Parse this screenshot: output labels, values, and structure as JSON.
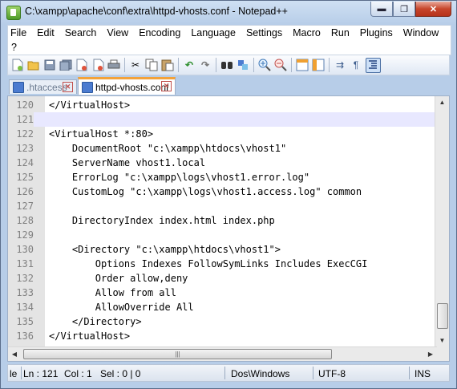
{
  "window": {
    "title": "C:\\xampp\\apache\\conf\\extra\\httpd-vhosts.conf - Notepad++",
    "controls": {
      "minimize": "▬",
      "maximize": "❐",
      "close": "✕"
    }
  },
  "menu": {
    "row1": [
      "File",
      "Edit",
      "Search",
      "View",
      "Encoding",
      "Language",
      "Settings",
      "Macro",
      "Run",
      "Plugins",
      "Window"
    ],
    "row2": [
      "?"
    ]
  },
  "toolbar": {
    "icons": [
      "new-file-icon",
      "open-file-icon",
      "save-icon",
      "save-all-icon",
      "close-icon",
      "close-all-icon",
      "print-icon",
      "cut-icon",
      "copy-icon",
      "paste-icon",
      "undo-icon",
      "redo-icon",
      "find-icon",
      "replace-icon",
      "zoom-in-icon",
      "zoom-out-icon",
      "sync-vertical-icon",
      "sync-horizontal-icon",
      "word-wrap-icon",
      "show-all-chars-icon",
      "indent-guide-icon"
    ]
  },
  "tabs": [
    {
      "label": ".htaccess",
      "active": false
    },
    {
      "label": "httpd-vhosts.conf",
      "active": true
    }
  ],
  "editor": {
    "current_line": "121",
    "lines": [
      {
        "num": "120",
        "text": "</VirtualHost>"
      },
      {
        "num": "121",
        "text": ""
      },
      {
        "num": "122",
        "text": "<VirtualHost *:80>"
      },
      {
        "num": "123",
        "text": "    DocumentRoot \"c:\\xampp\\htdocs\\vhost1\""
      },
      {
        "num": "124",
        "text": "    ServerName vhost1.local"
      },
      {
        "num": "125",
        "text": "    ErrorLog \"c:\\xampp\\logs\\vhost1.error.log\""
      },
      {
        "num": "126",
        "text": "    CustomLog \"c:\\xampp\\logs\\vhost1.access.log\" common"
      },
      {
        "num": "127",
        "text": ""
      },
      {
        "num": "128",
        "text": "    DirectoryIndex index.html index.php"
      },
      {
        "num": "129",
        "text": ""
      },
      {
        "num": "130",
        "text": "    <Directory \"c:\\xampp\\htdocs\\vhost1\">"
      },
      {
        "num": "131",
        "text": "        Options Indexes FollowSymLinks Includes ExecCGI"
      },
      {
        "num": "132",
        "text": "        Order allow,deny"
      },
      {
        "num": "133",
        "text": "        Allow from all"
      },
      {
        "num": "134",
        "text": "        AllowOverride All"
      },
      {
        "num": "135",
        "text": "    </Directory>"
      },
      {
        "num": "136",
        "text": "</VirtualHost>"
      }
    ]
  },
  "statusbar": {
    "length": "le",
    "ln": "Ln : 121",
    "col": "Col : 1",
    "sel": "Sel : 0 | 0",
    "eol": "Dos\\Windows",
    "encoding": "UTF-8",
    "mode": "INS"
  }
}
